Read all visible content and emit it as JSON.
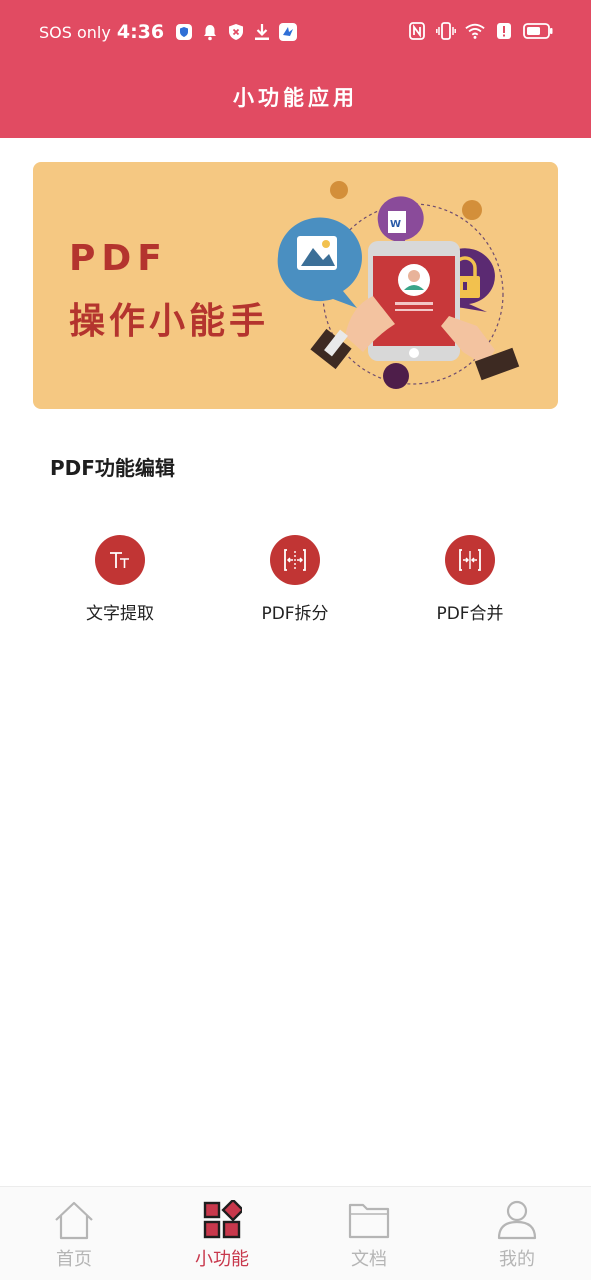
{
  "status_bar": {
    "carrier": "SOS only",
    "time": "4:36"
  },
  "header": {
    "title": "小功能应用"
  },
  "banner": {
    "line1": "PDF",
    "line2": "操作小能手"
  },
  "section": {
    "title": "PDF功能编辑"
  },
  "features": [
    {
      "label": "文字提取",
      "icon": "text-icon"
    },
    {
      "label": "PDF拆分",
      "icon": "split-icon"
    },
    {
      "label": "PDF合并",
      "icon": "merge-icon"
    }
  ],
  "bottom_nav": [
    {
      "label": "首页",
      "icon": "home-icon",
      "active": false
    },
    {
      "label": "小功能",
      "icon": "widgets-icon",
      "active": true
    },
    {
      "label": "文档",
      "icon": "folder-icon",
      "active": false
    },
    {
      "label": "我的",
      "icon": "user-icon",
      "active": false
    }
  ],
  "colors": {
    "header": "#e14b62",
    "accent": "#c13534",
    "banner_bg": "#f5c882",
    "nav_active": "#c8384c",
    "nav_inactive": "#b5b5b5"
  }
}
